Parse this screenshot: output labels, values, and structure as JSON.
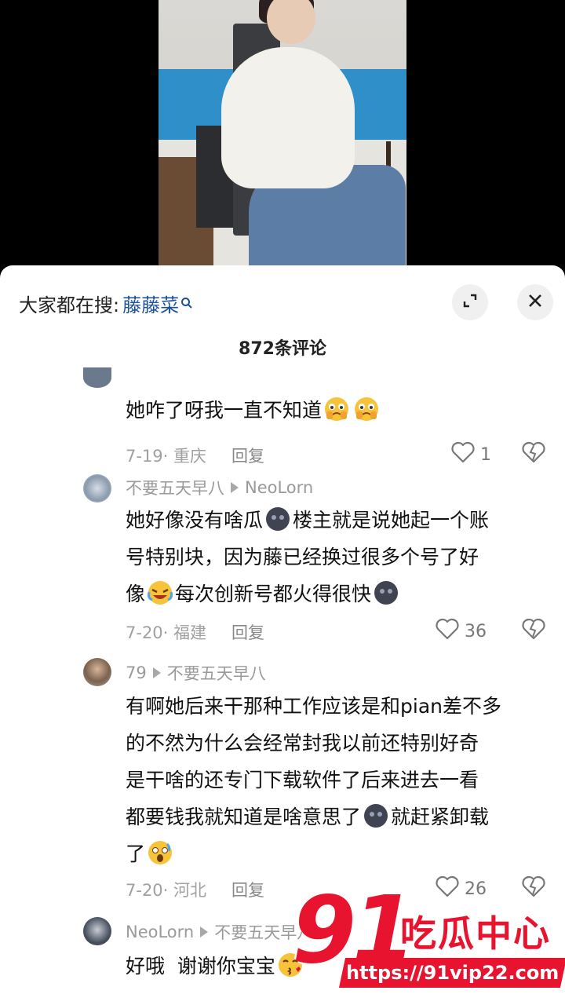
{
  "search": {
    "prefix": "大家都在搜:",
    "term": "藤藤菜"
  },
  "header": {
    "comment_count": "872条评论"
  },
  "comments": [
    {
      "text": "她咋了呀我一直不知道",
      "date_location": "7-19· 重庆",
      "reply": "回复",
      "likes": "1"
    },
    {
      "user": "不要五天早八",
      "reply_to": "NeoLorn",
      "lines": [
        "她好像没有啥瓜",
        "楼主就是说她起一个账",
        "号特别块，因为藤已经换过很多个号了好",
        "像",
        "每次创新号都火得很快"
      ],
      "date_location": "7-20· 福建",
      "reply": "回复",
      "likes": "36"
    },
    {
      "user": "79",
      "reply_to": "不要五天早八",
      "lines": [
        "有啊她后来干那种工作应该是和pian差不多",
        "的不然为什么会经常封我以前还特别好奇",
        "是干啥的还专门下载软件了后来进去一看",
        "都要钱我就知道是啥意思了",
        "就赶紧卸载",
        "了"
      ],
      "date_location": "7-20· 河北",
      "reply": "回复",
      "likes": "26"
    },
    {
      "user": "NeoLorn",
      "reply_to": "不要五天早八",
      "text": "好哦  谢谢你宝宝"
    }
  ],
  "watermark": {
    "number": "91",
    "site_name": "吃瓜中心",
    "url": "https://91vip22.com"
  },
  "icons": [
    "expand-icon",
    "close-icon",
    "heart-icon",
    "dislike-icon",
    "search-icon"
  ]
}
